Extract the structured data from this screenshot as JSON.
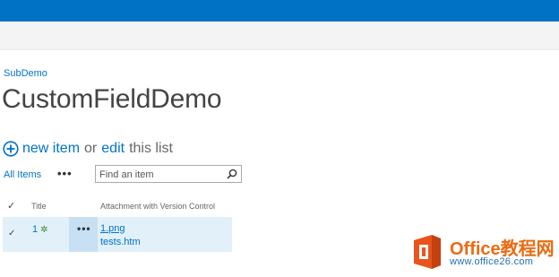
{
  "colors": {
    "suite_bar": "#0072c6",
    "ribbon": "#f4f4f4",
    "link": "#0072c6",
    "selected_row": "#e2f0fa"
  },
  "breadcrumb": "SubDemo",
  "page_title": "CustomFieldDemo",
  "command": {
    "new_item": "new item",
    "or": "or",
    "edit": "edit",
    "this_list": "this list"
  },
  "views": {
    "current": "All Items",
    "more": "•••"
  },
  "search": {
    "placeholder": "Find an item",
    "value": ""
  },
  "columns": {
    "check": "✓",
    "title": "Title",
    "attachment": "Attachment with Version Control"
  },
  "rows": [
    {
      "check": "✓",
      "id": "1",
      "new_badge": "✲",
      "menu": "•••",
      "attachments": [
        "1.png",
        "tests.htm"
      ]
    }
  ],
  "watermark": {
    "brand": "Office教程网",
    "url": "www.office26.com"
  }
}
